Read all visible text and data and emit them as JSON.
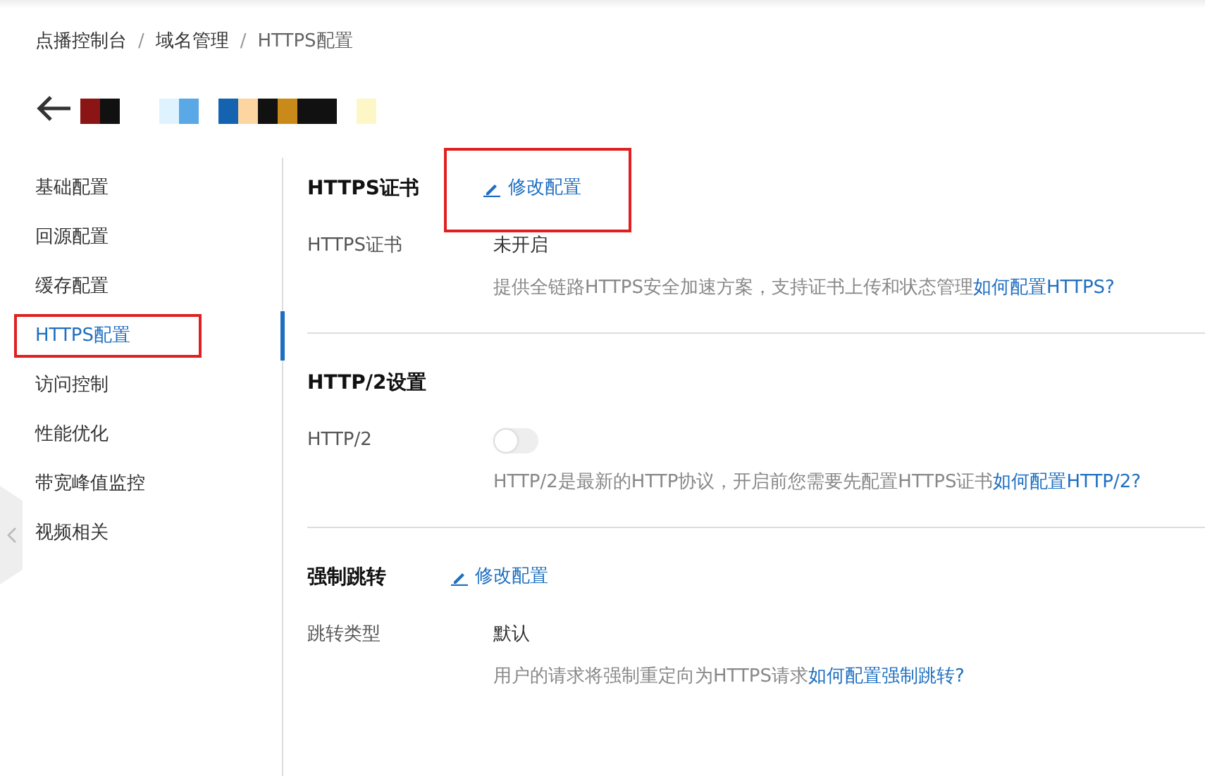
{
  "breadcrumb": [
    {
      "label": "点播控制台",
      "current": false
    },
    {
      "separator": "/"
    },
    {
      "label": "域名管理",
      "current": false
    },
    {
      "separator": "/"
    },
    {
      "label": "HTTPS配置",
      "current": true
    }
  ],
  "sidebar": {
    "items": [
      {
        "label": "基础配置",
        "selected": false,
        "annotated": false
      },
      {
        "label": "回源配置",
        "selected": false,
        "annotated": false
      },
      {
        "label": "缓存配置",
        "selected": false,
        "annotated": false
      },
      {
        "label": "HTTPS配置",
        "selected": true,
        "annotated": true
      },
      {
        "label": "访问控制",
        "selected": false,
        "annotated": false
      },
      {
        "label": "性能优化",
        "selected": false,
        "annotated": false
      },
      {
        "label": "带宽峰值监控",
        "selected": false,
        "annotated": false
      },
      {
        "label": "视频相关",
        "selected": false,
        "annotated": false
      }
    ]
  },
  "sections": [
    {
      "title": "HTTPS证书",
      "edit": {
        "label": "修改配置",
        "annotated": true
      },
      "fields": [
        {
          "label": "HTTPS证书",
          "kind": "text",
          "value": "未开启"
        }
      ],
      "description": {
        "text": "提供全链路HTTPS安全加速方案，支持证书上传和状态管理",
        "link": "如何配置HTTPS?"
      }
    },
    {
      "title": "HTTP/2设置",
      "fields": [
        {
          "label": "HTTP/2",
          "kind": "switch",
          "on": false
        }
      ],
      "description": {
        "text": "HTTP/2是最新的HTTP协议，开启前您需要先配置HTTPS证书",
        "link": "如何配置HTTP/2?"
      }
    },
    {
      "title": "强制跳转",
      "edit": {
        "label": "修改配置",
        "annotated": false
      },
      "fields": [
        {
          "label": "跳转类型",
          "kind": "text",
          "value": "默认"
        }
      ],
      "description": {
        "text": "用户的请求将强制重定向为HTTPS请求",
        "link": "如何配置强制跳转?"
      }
    }
  ]
}
